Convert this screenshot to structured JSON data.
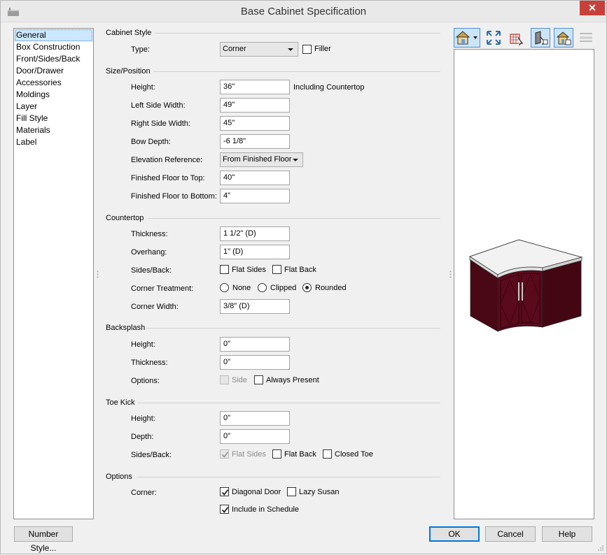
{
  "window": {
    "title": "Base Cabinet Specification",
    "close_glyph": "✕"
  },
  "nav": {
    "items": [
      "General",
      "Box Construction",
      "Front/Sides/Back",
      "Door/Drawer",
      "Accessories",
      "Moldings",
      "Layer",
      "Fill Style",
      "Materials",
      "Label"
    ],
    "selected": 0
  },
  "cabinet_style": {
    "header": "Cabinet Style",
    "type_label": "Type:",
    "type_value": "Corner",
    "filler_label": "Filler"
  },
  "size_position": {
    "header": "Size/Position",
    "height_label": "Height:",
    "height_value": "36\"",
    "height_note": "Including Countertop",
    "left_width_label": "Left Side Width:",
    "left_width_value": "49\"",
    "right_width_label": "Right Side Width:",
    "right_width_value": "45\"",
    "bow_depth_label": "Bow Depth:",
    "bow_depth_value": "-6 1/8\"",
    "elevation_label": "Elevation Reference:",
    "elevation_value": "From Finished Floor",
    "floor_top_label": "Finished Floor to Top:",
    "floor_top_value": "40\"",
    "floor_bottom_label": "Finished Floor to Bottom:",
    "floor_bottom_value": "4\""
  },
  "countertop": {
    "header": "Countertop",
    "thickness_label": "Thickness:",
    "thickness_value": "1 1/2\" (D)",
    "overhang_label": "Overhang:",
    "overhang_value": "1\" (D)",
    "sides_back_label": "Sides/Back:",
    "flat_sides_label": "Flat Sides",
    "flat_back_label": "Flat Back",
    "corner_treatment_label": "Corner Treatment:",
    "none_label": "None",
    "clipped_label": "Clipped",
    "rounded_label": "Rounded",
    "corner_width_label": "Corner Width:",
    "corner_width_value": "3/8\" (D)"
  },
  "backsplash": {
    "header": "Backsplash",
    "height_label": "Height:",
    "height_value": "0\"",
    "thickness_label": "Thickness:",
    "thickness_value": "0\"",
    "options_label": "Options:",
    "side_label": "Side",
    "always_present_label": "Always Present"
  },
  "toe_kick": {
    "header": "Toe Kick",
    "height_label": "Height:",
    "height_value": "0\"",
    "depth_label": "Depth:",
    "depth_value": "0\"",
    "sides_back_label": "Sides/Back:",
    "flat_sides_label": "Flat Sides",
    "flat_back_label": "Flat Back",
    "closed_toe_label": "Closed Toe"
  },
  "options": {
    "header": "Options",
    "corner_label": "Corner:",
    "diagonal_door_label": "Diagonal Door",
    "lazy_susan_label": "Lazy Susan",
    "include_schedule_label": "Include in Schedule"
  },
  "buttons": {
    "number_style": "Number Style...",
    "ok": "OK",
    "cancel": "Cancel",
    "help": "Help"
  },
  "colors": {
    "cabinet": "#5a0a1c",
    "countertop": "#f2f2f2",
    "selection": "#cce8ff",
    "accent": "#0078d7"
  },
  "toolbar_icons": [
    "camera-view-icon",
    "fill-window-icon",
    "show-layout-icon",
    "show-door-icon",
    "show-color-icon",
    "show-lines-icon"
  ]
}
